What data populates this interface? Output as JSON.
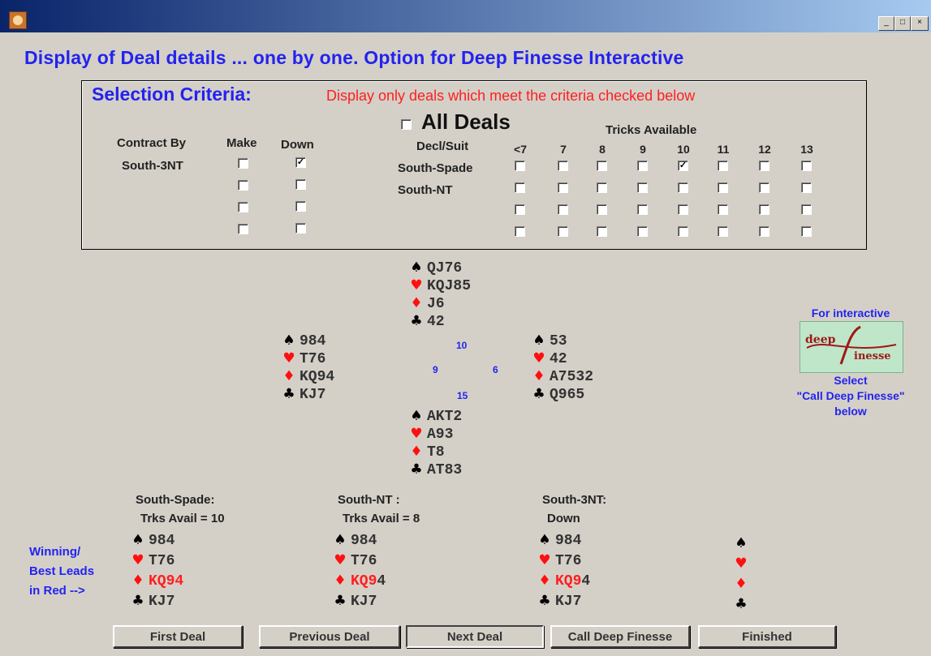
{
  "window": {
    "minimize_glyph": "_",
    "maximize_glyph": "□",
    "close_glyph": "×"
  },
  "heading": "Display of Deal details ... one by one. Option for Deep Finesse Interactive",
  "criteria": {
    "heading": "Selection Criteria:",
    "note": "Display only deals which meet the criteria checked below",
    "all_deals": {
      "label": "All Deals",
      "checked": false
    },
    "contract_header": "Contract  By",
    "make_header": "Make",
    "down_header": "Down",
    "contract_row_label": "South-3NT",
    "make_checks": [
      false,
      false,
      false,
      false
    ],
    "down_checks": [
      true,
      false,
      false,
      false
    ],
    "tricks_header": "Tricks Available",
    "decl_header": "Decl/Suit",
    "trick_columns": [
      "<7",
      "7",
      "8",
      "9",
      "10",
      "11",
      "12",
      "13"
    ],
    "decl_rows": [
      "South-Spade",
      "South-NT",
      "",
      ""
    ],
    "trick_checks": [
      [
        false,
        false,
        false,
        false,
        true,
        false,
        false,
        false
      ],
      [
        false,
        false,
        false,
        false,
        false,
        false,
        false,
        false
      ],
      [
        false,
        false,
        false,
        false,
        false,
        false,
        false,
        false
      ],
      [
        false,
        false,
        false,
        false,
        false,
        false,
        false,
        false
      ]
    ]
  },
  "deal": {
    "north": {
      "spades": "QJ76",
      "hearts": "KQJ85",
      "diamonds": "J6",
      "clubs": "42"
    },
    "west": {
      "spades": "984",
      "hearts": "T76",
      "diamonds": "KQ94",
      "clubs": "KJ7"
    },
    "east": {
      "spades": "53",
      "hearts": "42",
      "diamonds": "A7532",
      "clubs": "Q965"
    },
    "south": {
      "spades": "AKT2",
      "hearts": "A93",
      "diamonds": "T8",
      "clubs": "AT83"
    },
    "hcp": {
      "north": "10",
      "west": "9",
      "east": "6",
      "south": "15"
    }
  },
  "suit_icons": {
    "spade": "♠",
    "heart": "♥",
    "diamond": "♦",
    "club": "♣"
  },
  "deep_finesse": {
    "caption": "For interactive",
    "logo_text_1": "deep",
    "logo_text_2": "inesse",
    "select_text": "Select",
    "call_text": "\"Call Deep Finesse\"",
    "below_text": "below"
  },
  "leads_note": [
    "Winning/",
    "Best Leads",
    "in Red -->"
  ],
  "leads": [
    {
      "title": "South-Spade:",
      "subtitle": "Trks Avail = 10",
      "spades": "984",
      "hearts": "T76",
      "diamonds_red": "KQ94",
      "diamonds_rest": "",
      "clubs": "KJ7"
    },
    {
      "title": "South-NT   :",
      "subtitle": "Trks Avail = 8",
      "spades": "984",
      "hearts": "T76",
      "diamonds_red": "KQ9",
      "diamonds_rest": "4",
      "clubs": "KJ7"
    },
    {
      "title": "South-3NT:",
      "subtitle": "Down",
      "spades": "984",
      "hearts": "T76",
      "diamonds_red": "KQ9",
      "diamonds_rest": "4",
      "clubs": "KJ7"
    }
  ],
  "buttons": {
    "first": "First Deal",
    "previous": "Previous Deal",
    "next": "Next Deal",
    "call": "Call Deep Finesse",
    "finished": "Finished"
  },
  "colors": {
    "heading_blue": "#2323ee",
    "note_red": "#ff1f1f",
    "window_bg": "#d4d0c8"
  }
}
